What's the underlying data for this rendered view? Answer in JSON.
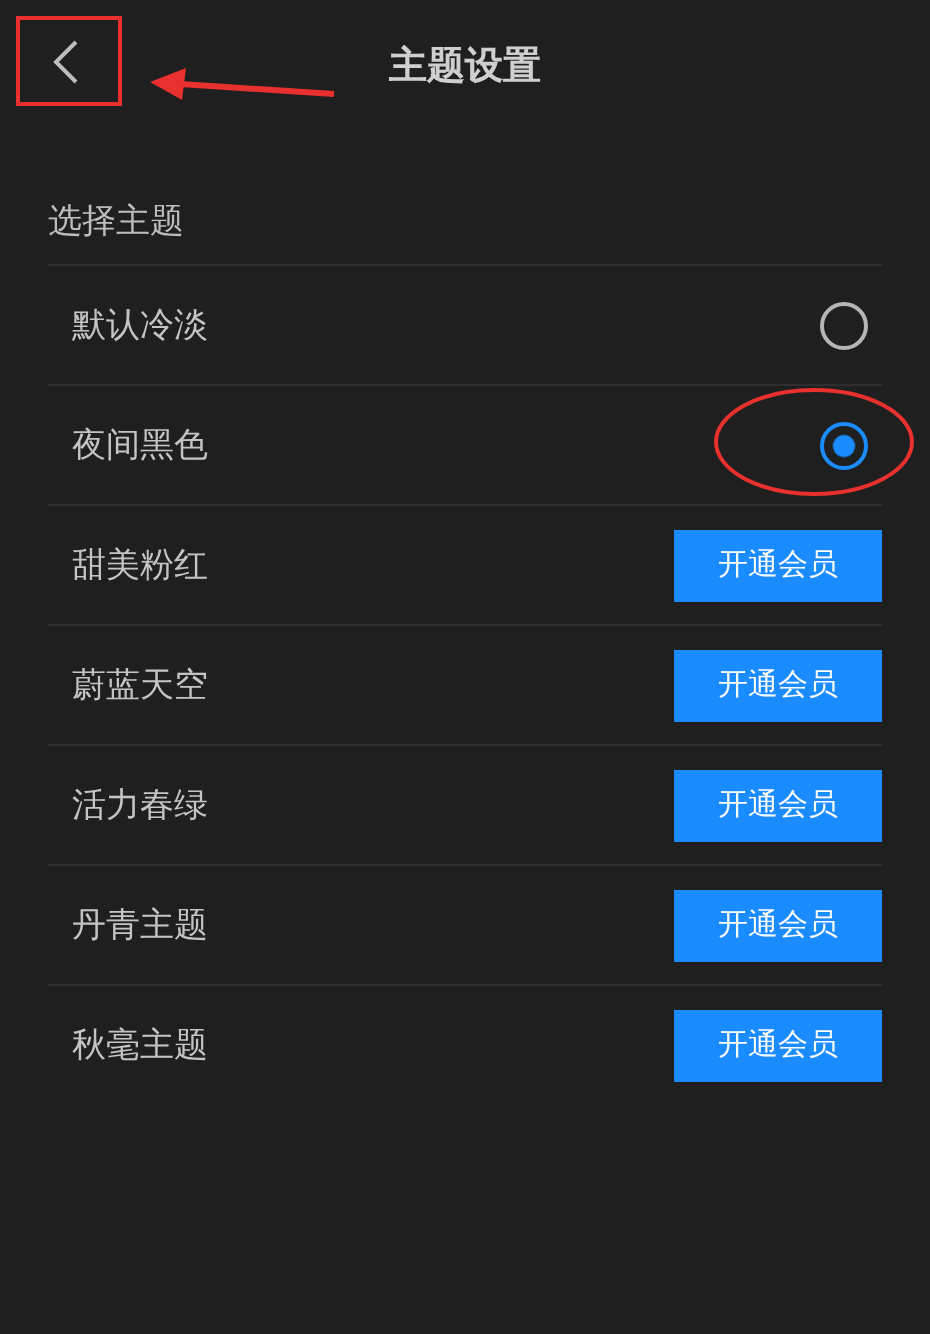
{
  "header": {
    "title": "主题设置"
  },
  "section": {
    "label": "选择主题"
  },
  "themes": [
    {
      "label": "默认冷淡",
      "kind": "radio",
      "selected": false
    },
    {
      "label": "夜间黑色",
      "kind": "radio",
      "selected": true
    },
    {
      "label": "甜美粉红",
      "kind": "button",
      "button": "开通会员"
    },
    {
      "label": "蔚蓝天空",
      "kind": "button",
      "button": "开通会员"
    },
    {
      "label": "活力春绿",
      "kind": "button",
      "button": "开通会员"
    },
    {
      "label": "丹青主题",
      "kind": "button",
      "button": "开通会员"
    },
    {
      "label": "秋毫主题",
      "kind": "button",
      "button": "开通会员"
    }
  ]
}
